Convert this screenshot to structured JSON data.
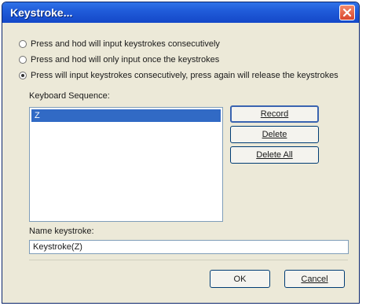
{
  "window": {
    "title": "Keystroke..."
  },
  "options": [
    {
      "label": "Press and hod will input keystrokes consecutively",
      "checked": false
    },
    {
      "label": "Press and hod will only input once the keystrokes",
      "checked": false
    },
    {
      "label": "Press will input keystrokes consecutively, press again will release the keystrokes",
      "checked": true
    }
  ],
  "sequence": {
    "label": "Keyboard Sequence:",
    "items": [
      "Z"
    ]
  },
  "buttons": {
    "record": "Record",
    "delete": "Delete",
    "delete_all": "Delete All",
    "ok": "OK",
    "cancel": "Cancel"
  },
  "name": {
    "label": "Name keystroke:",
    "value": "Keystroke(Z)"
  },
  "colors": {
    "titlebar": "#1f5ad8",
    "selection": "#316ac5",
    "close": "#d9462d"
  }
}
